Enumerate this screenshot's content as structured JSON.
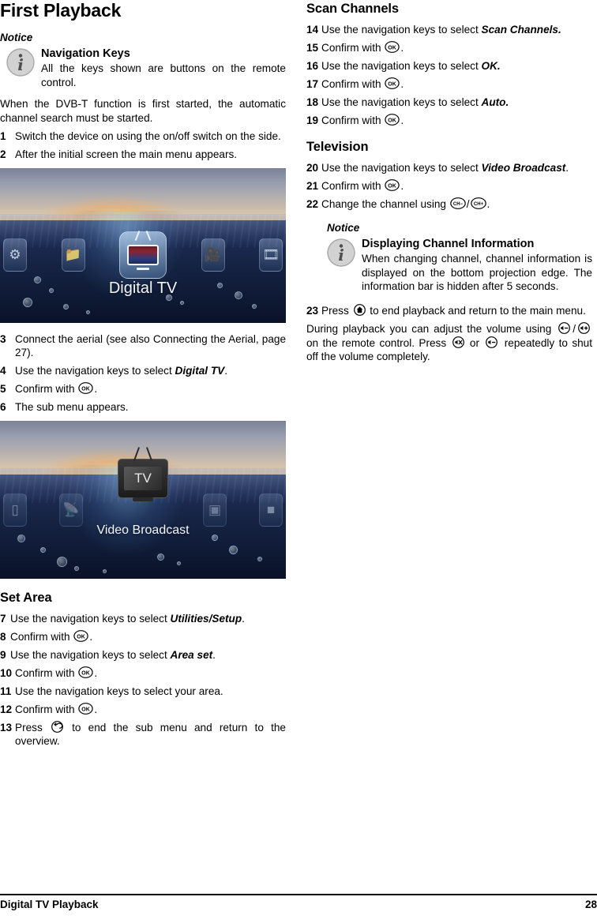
{
  "page": {
    "title": "First Playback",
    "footer_left": "Digital TV Playback",
    "footer_page": "28"
  },
  "left_column": {
    "notice": {
      "label": "Notice",
      "icon": "info-icon",
      "heading": "Navigation Keys",
      "text": "All the keys shown are buttons on the remote control."
    },
    "intro": "When the DVB-T function is first started, the automatic channel search must be started.",
    "steps": [
      {
        "num": "1",
        "text": "Switch the device on using the on/off switch on the side."
      },
      {
        "num": "2",
        "text": "After the initial screen the main menu appears."
      }
    ],
    "screenshot_one": {
      "caption": "Digital TV",
      "alt": "main-menu-projection"
    },
    "steps_b": [
      {
        "num": "3",
        "text": "Connect the aerial (see also Connecting the Aerial, page 27)."
      },
      {
        "num": "4",
        "text": "Use the navigation keys to select ",
        "keyword": "Digital TV",
        "tail": "."
      },
      {
        "num": "5",
        "text": "Confirm with ",
        "key": "ok-key",
        "tail": "."
      },
      {
        "num": "6",
        "text": "The sub menu appears."
      }
    ],
    "screenshot_two": {
      "caption": "Video Broadcast",
      "screen_label": "TV",
      "alt": "video-broadcast-projection"
    },
    "set_area": {
      "heading": "Set Area",
      "steps": [
        {
          "num": "7",
          "text": "Use the navigation keys to select ",
          "keyword": "Utilities/Setup",
          "tail": "."
        },
        {
          "num": "8",
          "text": "Confirm with ",
          "key": "ok-key",
          "tail": "."
        },
        {
          "num": "9",
          "text": "Use the navigation keys to select ",
          "keyword": "Area set",
          "tail": "."
        },
        {
          "num": "10",
          "text": "Confirm with ",
          "key": "ok-key",
          "tail": "."
        },
        {
          "num": "11",
          "text": "Use the navigation keys to select your area."
        },
        {
          "num": "12",
          "text": "Confirm with ",
          "key": "ok-key",
          "tail": "."
        },
        {
          "num": "13",
          "text": "Press ",
          "key": "back-key",
          "tail": " to end the sub menu and return to the overview."
        }
      ]
    }
  },
  "right_column": {
    "scan_channels": {
      "heading": "Scan Channels",
      "steps": [
        {
          "num": "14",
          "text": "Use the navigation keys to select ",
          "keyword": "Scan Channels.",
          "tail": ""
        },
        {
          "num": "15",
          "text": "Confirm with ",
          "key": "ok-key",
          "tail": "."
        },
        {
          "num": "16",
          "text": "Use the navigation keys to select ",
          "keyword": "OK.",
          "tail": ""
        },
        {
          "num": "17",
          "text": "Confirm with ",
          "key": "ok-key",
          "tail": "."
        },
        {
          "num": "18",
          "text": "Use the navigation keys to select ",
          "keyword": "Auto.",
          "tail": ""
        },
        {
          "num": "19",
          "text": "Confirm with ",
          "key": "ok-key",
          "tail": "."
        }
      ]
    },
    "television": {
      "heading": "Television",
      "steps": [
        {
          "num": "20",
          "text": "Use the navigation keys to select ",
          "keyword": "Video Broadcast",
          "tail": "."
        },
        {
          "num": "21",
          "text": "Confirm with ",
          "key": "ok-key",
          "tail": "."
        },
        {
          "num": "22",
          "text": "Change the channel using ",
          "key": "ch-minus-key",
          "sep": "/",
          "key2": "ch-plus-key",
          "tail": "."
        }
      ]
    },
    "notice": {
      "label": "Notice",
      "icon": "info-icon",
      "heading": "Displaying Channel Information",
      "text": "When changing channel, channel information is displayed on the bottom projection edge. The information bar is hidden after 5 seconds."
    },
    "step_23": {
      "num": "23",
      "lead": "Press ",
      "key": "home-key",
      "tail": " to end playback and return to the main menu."
    },
    "volume_paragraph": {
      "part1": "During playback you can adjust the volume using ",
      "key1": "volume-down-key",
      "sep": "/",
      "key2": "volume-up-key",
      "part2": " on the remote control. Press ",
      "key3": "mute-key",
      "part3": " or ",
      "key4": "volume-down-key",
      "part4": " repeatedly to shut off the volume completely."
    }
  },
  "colors": {
    "text": "#000000",
    "info_icon_fill": "#cfcfcf",
    "info_icon_glyph": "#58595b",
    "rule": "#000000"
  }
}
